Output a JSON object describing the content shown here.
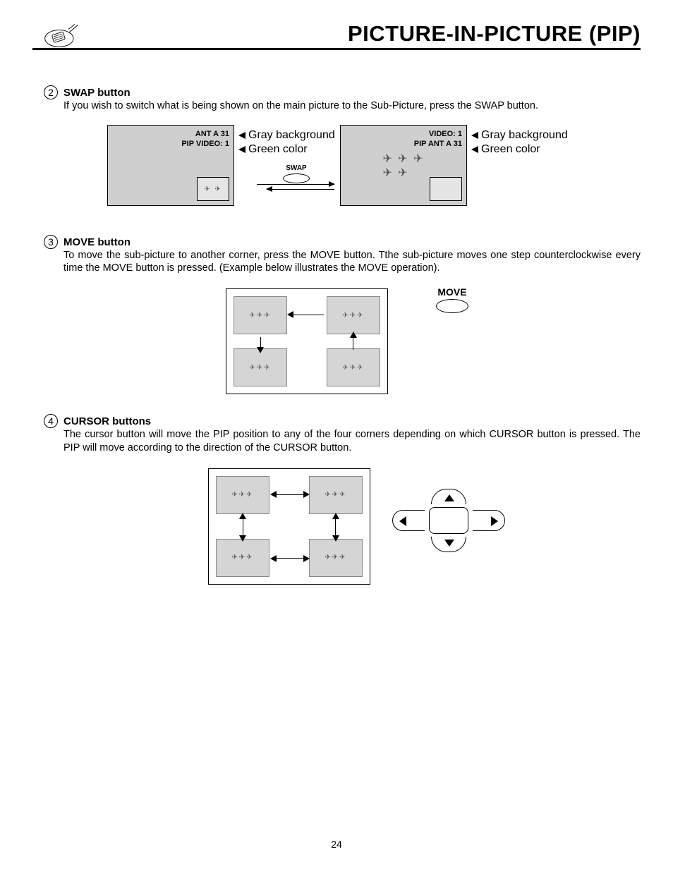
{
  "header": {
    "title": "PICTURE-IN-PICTURE (PIP)"
  },
  "sections": {
    "swap": {
      "num": "2",
      "title": "SWAP button",
      "body": "If you wish to switch what is being shown on the main picture to the Sub-Picture, press the SWAP button.",
      "left_tv": {
        "line1": "ANT  A 31",
        "line2": "PIP   VIDEO: 1"
      },
      "right_tv": {
        "line1": "VIDEO: 1",
        "line2": "PIP   ANT  A 31"
      },
      "note_gray": "Gray background",
      "note_green": "Green color",
      "btn_label": "SWAP"
    },
    "move": {
      "num": "3",
      "title": "MOVE button",
      "body": "To move the sub-picture to another corner, press the MOVE button. Tthe sub-picture moves one step counterclockwise every time the MOVE button is pressed.  (Example below illustrates the MOVE operation).",
      "btn_label": "MOVE"
    },
    "cursor": {
      "num": "4",
      "title": "CURSOR buttons",
      "body": "The cursor button will move the PIP position to any of the four corners depending on which CURSOR button is pressed.  The PIP will move according to the direction of the CURSOR button."
    }
  },
  "page_number": "24"
}
